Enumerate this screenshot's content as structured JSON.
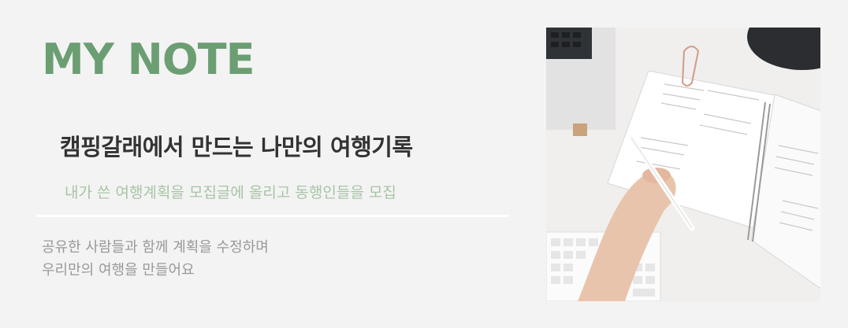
{
  "banner": {
    "title": "MY NOTE",
    "headline": "캠핑갈래에서 만드는 나만의 여행기록",
    "subheadline": "내가 쓴 여행계획을 모집글에 올리고 동행인들을 모집",
    "description_lines": [
      "공유한 사람들과 함께 계획을 수정하며",
      "우리만의 여행을 만들어요"
    ],
    "photo": {
      "alt": "planner-on-desk-photo"
    }
  },
  "colors": {
    "background": "#f3f3f3",
    "title": "#6b9e72",
    "headline": "#333333",
    "subheadline": "#a8c4a6",
    "description": "#999999"
  }
}
